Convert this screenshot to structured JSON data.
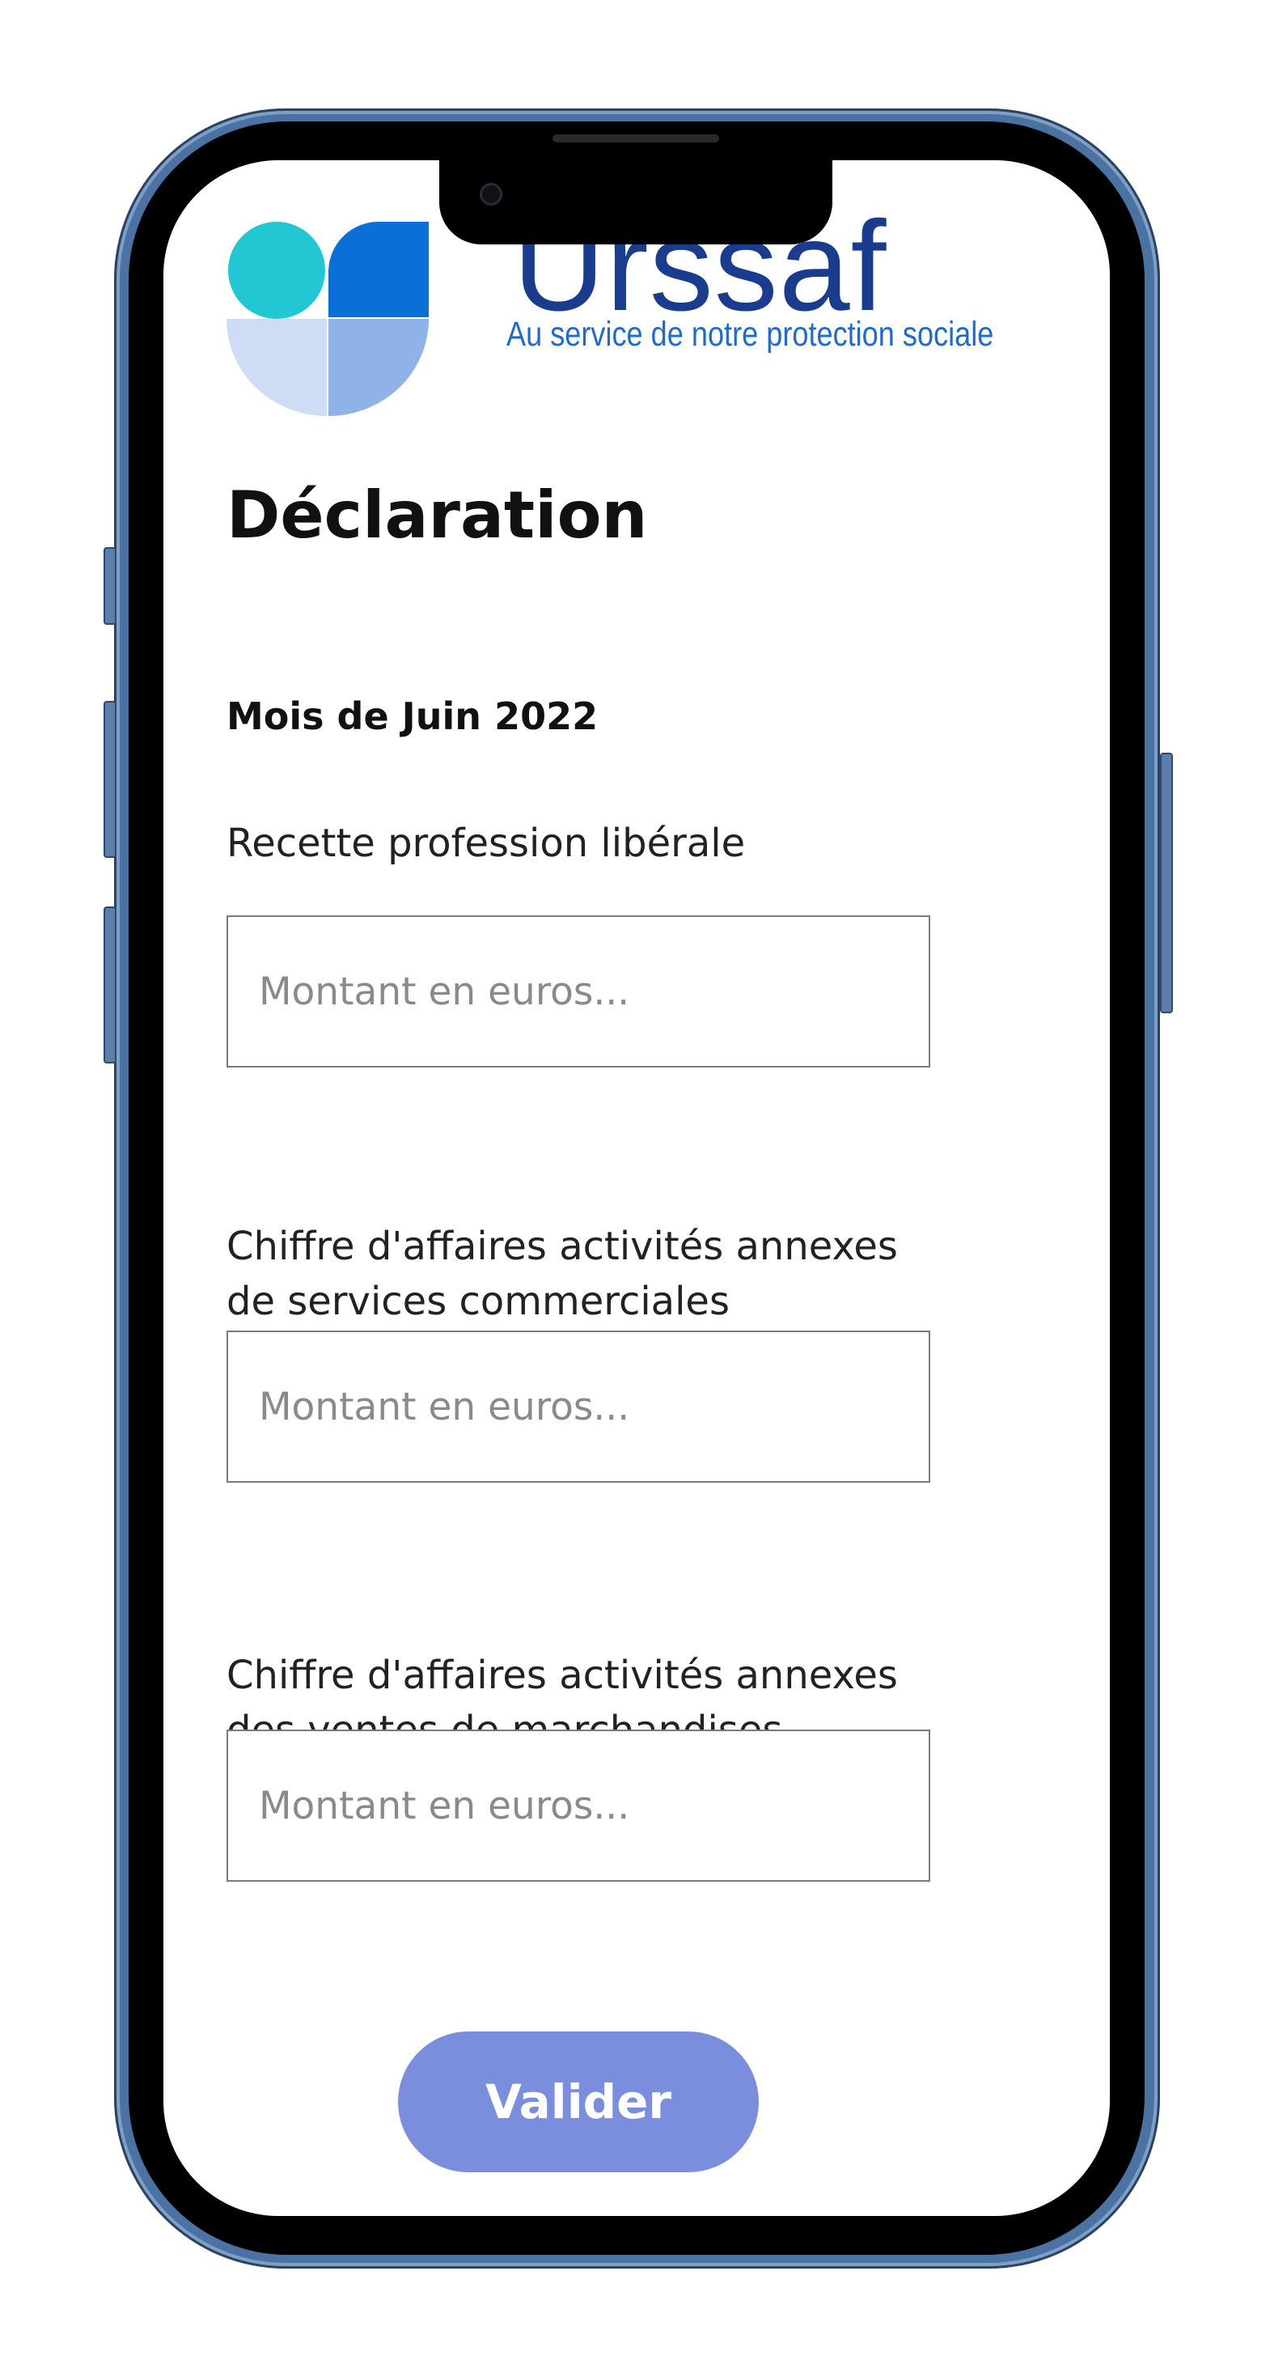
{
  "brand": {
    "name": "Urssaf",
    "tagline": "Au service de notre protection sociale",
    "colors": {
      "teal": "#22c7d4",
      "blue": "#0a6fd6",
      "light_blue": "#cfdcf5",
      "mid_blue": "#8fb2e8",
      "name_color": "#1a3c8f"
    }
  },
  "page": {
    "title": "Déclaration",
    "period": "Mois de Juin 2022"
  },
  "form": {
    "fields": [
      {
        "label": "Recette profession libérale",
        "placeholder": "Montant en euros...",
        "value": ""
      },
      {
        "label": "Chiffre d'affaires activités annexes de services commerciales",
        "placeholder": "Montant en euros...",
        "value": ""
      },
      {
        "label": "Chiffre d'affaires activités annexes des ventes de marchandises",
        "placeholder": "Montant en euros...",
        "value": ""
      }
    ],
    "submit_label": "Valider",
    "submit_color": "#7b8ddd"
  }
}
